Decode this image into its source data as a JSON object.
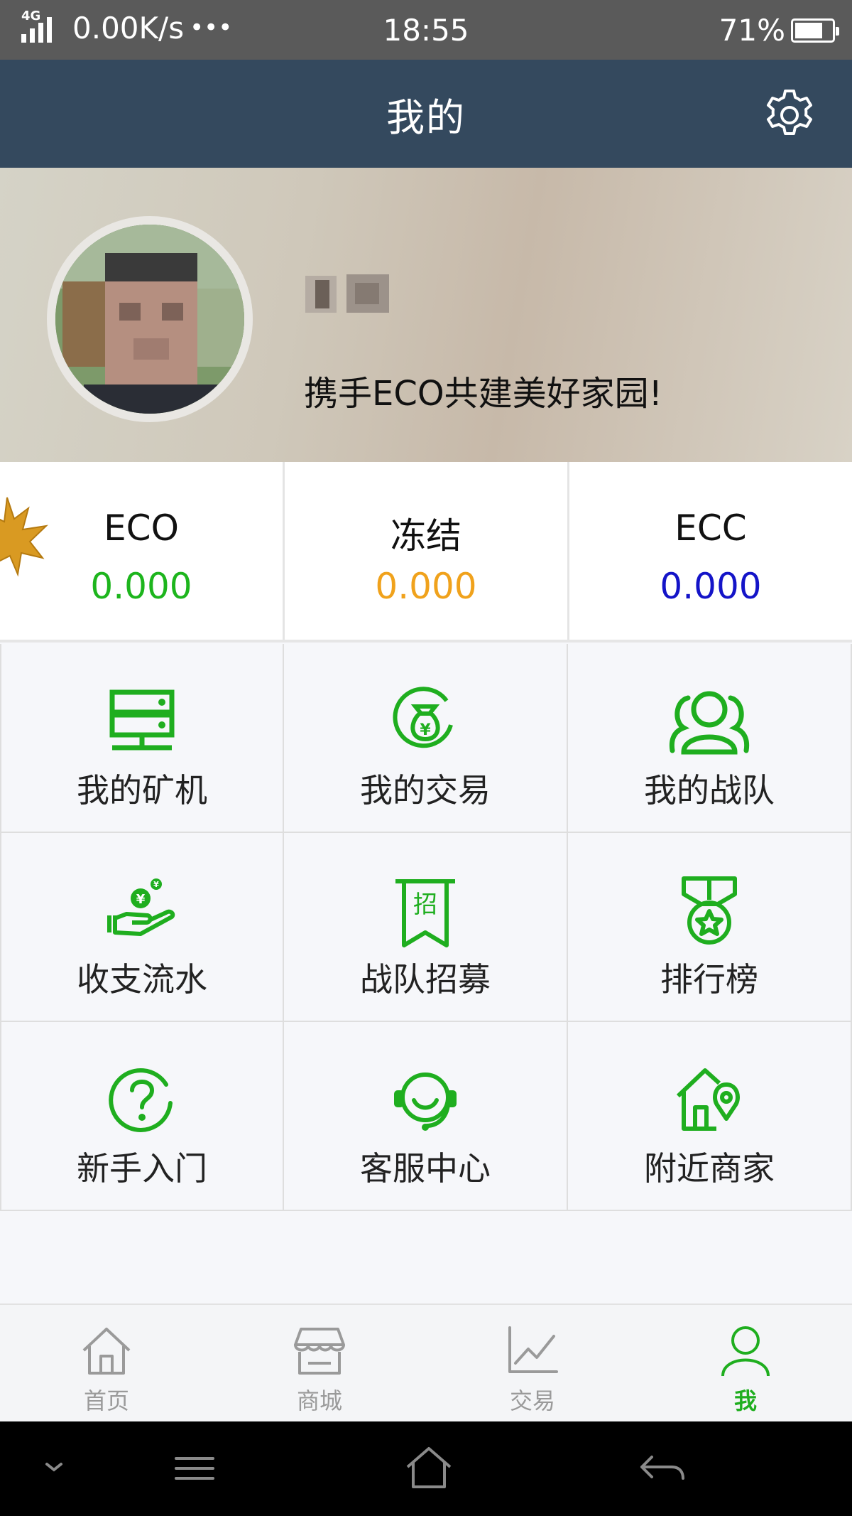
{
  "status_bar": {
    "network": "4G",
    "speed": "0.00K/s",
    "dots": "•••",
    "time": "18:55",
    "battery": "71%"
  },
  "header": {
    "title": "我的",
    "settings_icon": "gear-icon"
  },
  "profile": {
    "motto": "携手ECO共建美好家园!"
  },
  "balances": [
    {
      "label": "ECO",
      "value": "0.000",
      "color": "#1db51d"
    },
    {
      "label": "冻结",
      "value": "0.000",
      "color": "#f0a21c"
    },
    {
      "label": "ECC",
      "value": "0.000",
      "color": "#1414c8"
    }
  ],
  "menu": [
    {
      "label": "我的矿机",
      "icon": "server-icon"
    },
    {
      "label": "我的交易",
      "icon": "money-bag-icon"
    },
    {
      "label": "我的战队",
      "icon": "team-icon"
    },
    {
      "label": "收支流水",
      "icon": "hand-coin-icon"
    },
    {
      "label": "战队招募",
      "icon": "recruit-banner-icon"
    },
    {
      "label": "排行榜",
      "icon": "medal-icon"
    },
    {
      "label": "新手入门",
      "icon": "question-icon"
    },
    {
      "label": "客服中心",
      "icon": "headset-icon"
    },
    {
      "label": "附近商家",
      "icon": "house-location-icon"
    }
  ],
  "menu_banner_char": "招",
  "bottom_nav": [
    {
      "label": "首页",
      "icon": "home-icon",
      "active": false
    },
    {
      "label": "商城",
      "icon": "store-icon",
      "active": false
    },
    {
      "label": "交易",
      "icon": "chart-icon",
      "active": false
    },
    {
      "label": "我",
      "icon": "user-icon",
      "active": true
    }
  ],
  "colors": {
    "accent_green": "#1fae1f",
    "header_bg": "#34495e"
  }
}
